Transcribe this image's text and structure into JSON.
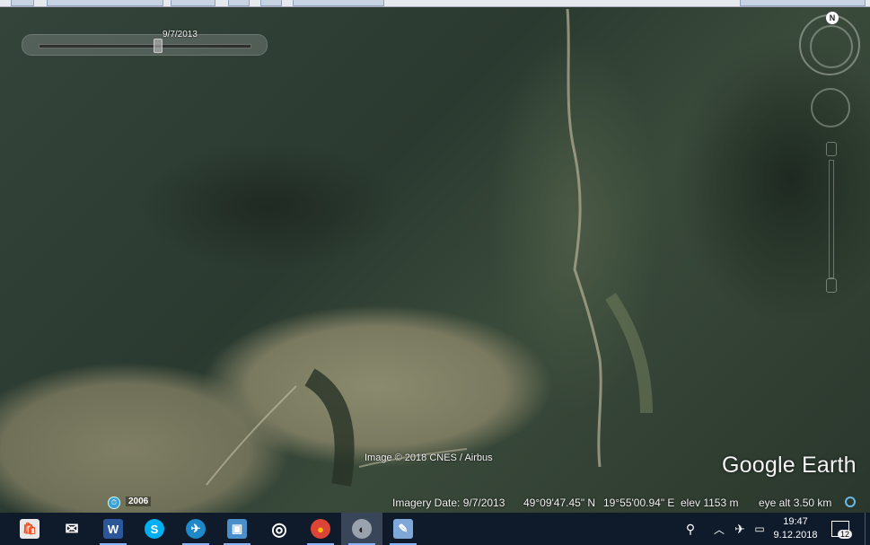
{
  "map": {
    "time_slider_date": "9/7/2013",
    "attribution": "Image © 2018 CNES / Airbus",
    "brand": "Google Earth",
    "historical_year": "2006",
    "north_label": "N"
  },
  "status_bar": {
    "imagery_date": "Imagery Date: 9/7/2013",
    "latitude": "49°09'47.45\" N",
    "longitude": "19°55'00.94\" E",
    "elevation": "elev  1153 m",
    "eye_altitude": "eye alt   3.50 km"
  },
  "taskbar": {
    "items": [
      {
        "name": "store-icon",
        "glyph": "🛍"
      },
      {
        "name": "mail-icon",
        "glyph": "✉"
      },
      {
        "name": "word-icon",
        "glyph": "W"
      },
      {
        "name": "skype-icon",
        "glyph": "S"
      },
      {
        "name": "airplane-app-icon",
        "glyph": "✈"
      },
      {
        "name": "photos-icon",
        "glyph": "▣"
      },
      {
        "name": "media-player-icon",
        "glyph": "◎"
      },
      {
        "name": "chrome-icon",
        "glyph": "●"
      },
      {
        "name": "google-earth-icon",
        "glyph": "◐"
      },
      {
        "name": "paint-icon",
        "glyph": "✎"
      }
    ],
    "clock_time": "19:47",
    "clock_date": "9.12.2018",
    "notification_count": "12"
  },
  "colors": {
    "taskbar_bg": "#0f1a2a",
    "active_item": "#394659",
    "word_blue": "#2b579a",
    "skype_blue": "#00aff0",
    "chrome_red": "#db4437"
  }
}
